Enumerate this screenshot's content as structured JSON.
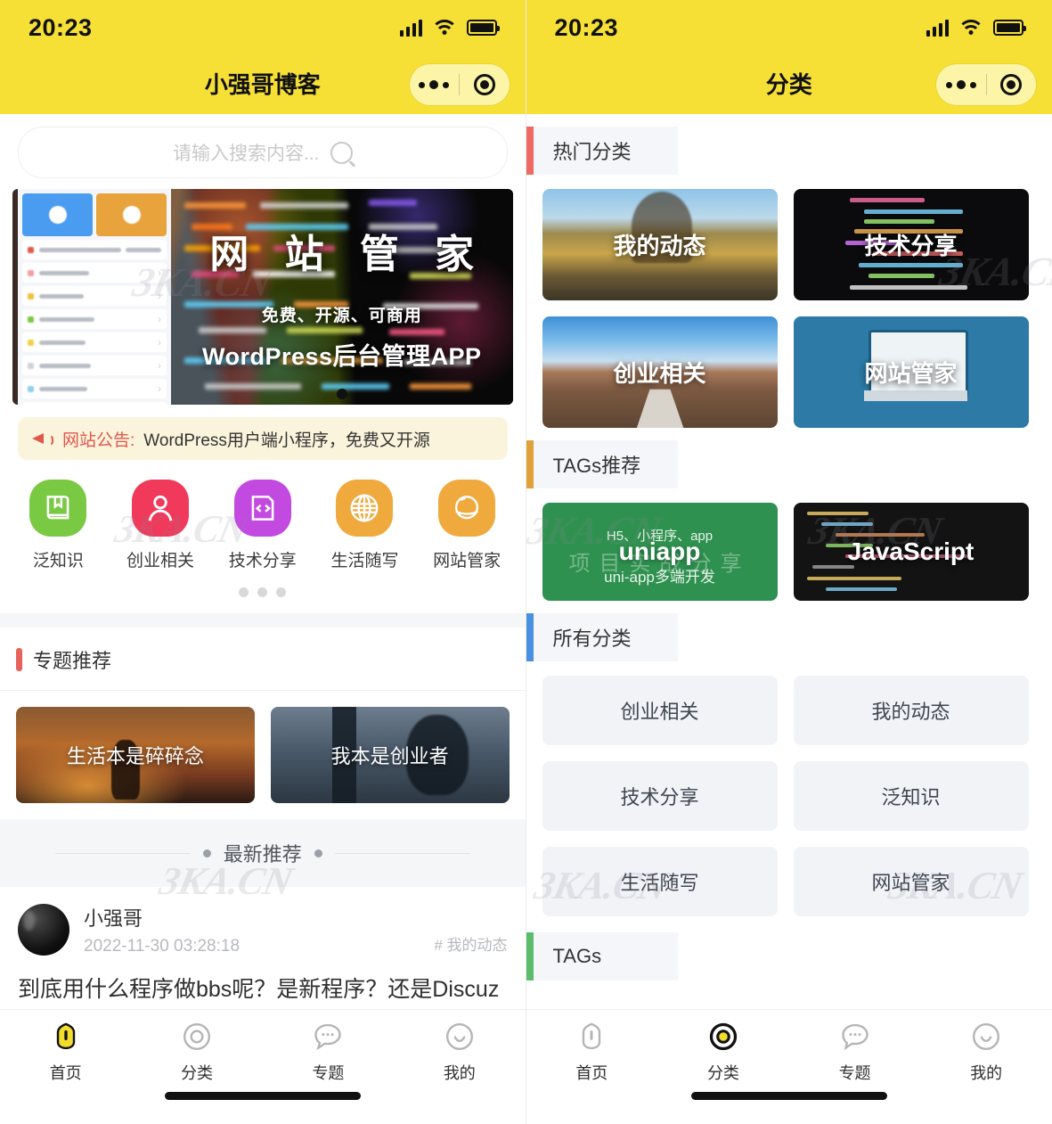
{
  "status_bar": {
    "time": "20:23"
  },
  "left_screen": {
    "nav_title": "小强哥博客",
    "search": {
      "placeholder": "请输入搜索内容...",
      "value": ""
    },
    "banner": {
      "title": "网 站 管 家",
      "subtitle": "免费、开源、可商用",
      "caption": "WordPress后台管理APP"
    },
    "notice": {
      "label": "网站公告:",
      "text": "WordPress用户端小程序，免费又开源"
    },
    "quick_icons": [
      {
        "label": "泛知识",
        "icon": "book-icon",
        "color": "#7ac943"
      },
      {
        "label": "创业相关",
        "icon": "person-icon",
        "color": "#f0395b"
      },
      {
        "label": "技术分享",
        "icon": "code-icon",
        "color": "#c24ae0"
      },
      {
        "label": "生活随写",
        "icon": "globe-icon",
        "color": "#f0a93c"
      },
      {
        "label": "网站管家",
        "icon": "planet-icon",
        "color": "#f0a93c"
      }
    ],
    "carousel_dots": 3,
    "topic_section": {
      "title": "专题推荐",
      "accent": "#e8625c"
    },
    "topics": [
      {
        "title": "生活本是碎碎念"
      },
      {
        "title": "我本是创业者"
      }
    ],
    "latest_divider": "最新推荐",
    "post": {
      "author": "小强哥",
      "date": "2022-11-30 03:28:18",
      "tag": "# 我的动态",
      "body": "到底用什么程序做bbs呢？是新程序？还是Discuz x？还是DiscuzQ？ 还是自己开发？ 还是bbpress？ 惆"
    },
    "tabbar": [
      {
        "label": "首页",
        "icon": "home-icon",
        "active": true
      },
      {
        "label": "分类",
        "icon": "category-icon",
        "active": false
      },
      {
        "label": "专题",
        "icon": "chat-icon",
        "active": false
      },
      {
        "label": "我的",
        "icon": "profile-icon",
        "active": false
      }
    ]
  },
  "right_screen": {
    "nav_title": "分类",
    "sections": [
      {
        "title": "热门分类",
        "accent": "#ef6a62"
      },
      {
        "title": "TAGs推荐",
        "accent": "#e0a13a"
      },
      {
        "title": "所有分类",
        "accent": "#4a90e2"
      },
      {
        "title": "TAGs",
        "accent": "#5bbd6a"
      }
    ],
    "hot_categories": [
      {
        "title": "我的动态",
        "image": "autumn-trees-photo"
      },
      {
        "title": "技术分享",
        "image": "code-editor-photo"
      },
      {
        "title": "创业相关",
        "image": "desert-road-photo"
      },
      {
        "title": "网站管家",
        "image": "open-source-illustration"
      }
    ],
    "tag_cards": [
      {
        "title": "uniapp",
        "top_text": "H5、小程序、app",
        "bottom_text": "uni-app多端开发",
        "ghost_text": "项目实战分享",
        "bg": "#2f9150"
      },
      {
        "title": "JavaScript",
        "bg": "#131313"
      }
    ],
    "all_categories": [
      "创业相关",
      "我的动态",
      "技术分享",
      "泛知识",
      "生活随写",
      "网站管家"
    ],
    "tabbar": [
      {
        "label": "首页",
        "icon": "home-icon",
        "active": false
      },
      {
        "label": "分类",
        "icon": "category-icon",
        "active": true
      },
      {
        "label": "专题",
        "icon": "chat-icon",
        "active": false
      },
      {
        "label": "我的",
        "icon": "profile-icon",
        "active": false
      }
    ]
  },
  "watermark": "3KA.CN",
  "theme": {
    "header_bg": "#F7E036",
    "tab_active": "#F2DC2E"
  }
}
